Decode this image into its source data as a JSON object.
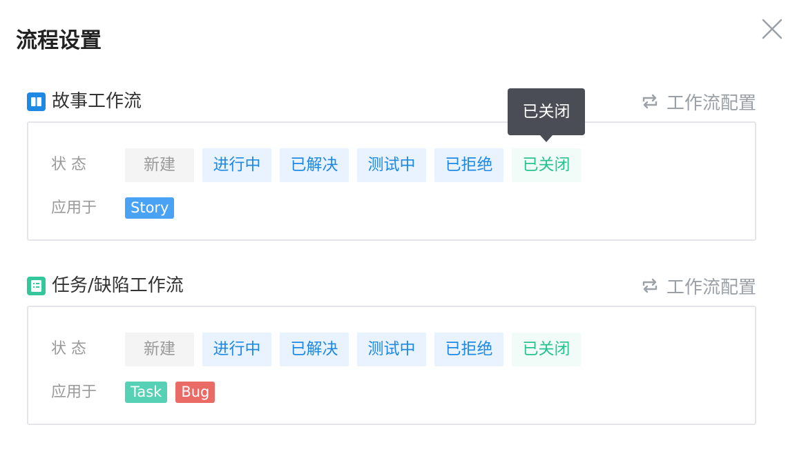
{
  "dialog": {
    "title": "流程设置"
  },
  "labels": {
    "status": "状 态",
    "applies_to": "应用于",
    "config_link": "工作流配置"
  },
  "workflows": [
    {
      "title": "故事工作流",
      "icon": "book-icon",
      "icon_color": "#1e88e5",
      "statuses": [
        "新建",
        "进行中",
        "已解决",
        "测试中",
        "已拒绝",
        "已关闭"
      ],
      "tags": [
        {
          "label": "Story",
          "color": "#4aa2f5"
        }
      ]
    },
    {
      "title": "任务/缺陷工作流",
      "icon": "checklist-icon",
      "icon_color": "#34c79b",
      "statuses": [
        "新建",
        "进行中",
        "已解决",
        "测试中",
        "已拒绝",
        "已关闭"
      ],
      "tags": [
        {
          "label": "Task",
          "color": "#56d1b5"
        },
        {
          "label": "Bug",
          "color": "#ea6b66"
        }
      ]
    }
  ],
  "tooltip": {
    "text": "已关闭"
  }
}
